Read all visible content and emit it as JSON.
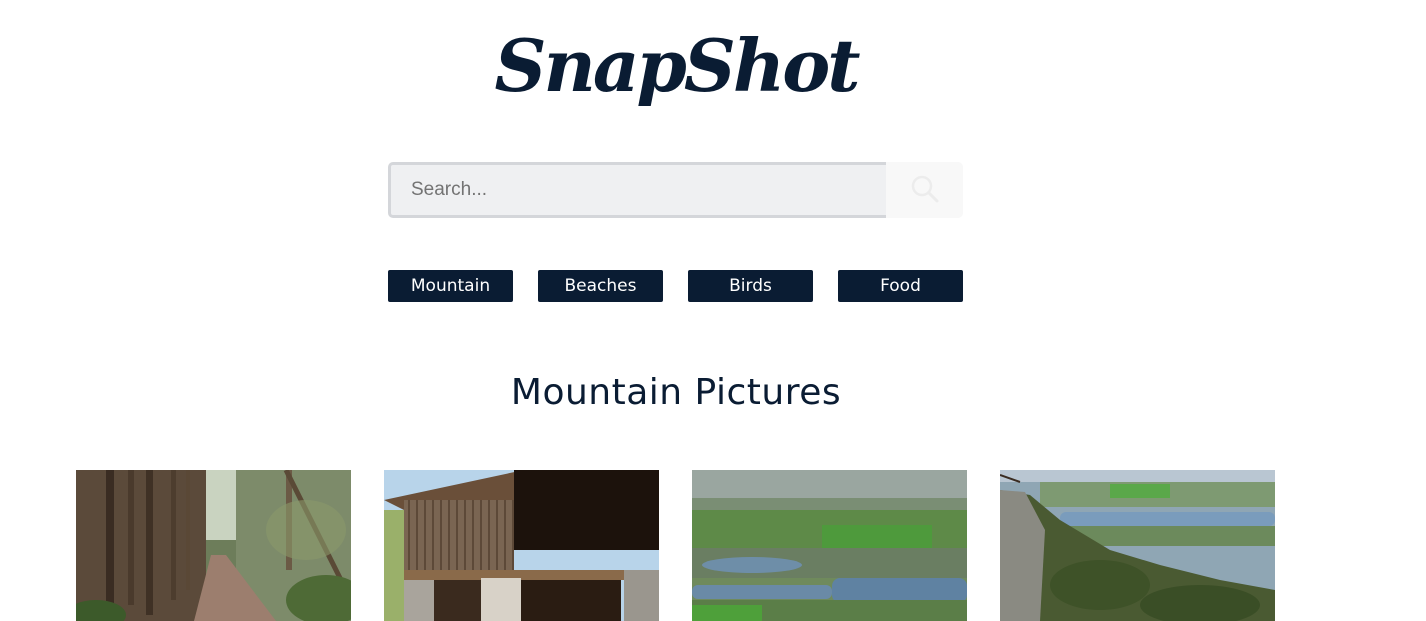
{
  "header": {
    "logo_text": "SnapShot"
  },
  "search": {
    "placeholder": "Search...",
    "value": ""
  },
  "categories": [
    {
      "label": "Mountain"
    },
    {
      "label": "Beaches"
    },
    {
      "label": "Birds"
    },
    {
      "label": "Food"
    }
  ],
  "main": {
    "title": "Mountain Pictures"
  },
  "gallery": [
    {
      "subject": "forest-trail"
    },
    {
      "subject": "wooden-barn"
    },
    {
      "subject": "valley-lakes"
    },
    {
      "subject": "cliff-valley"
    }
  ],
  "colors": {
    "brand": "#0a1c33",
    "search_bg": "#eff0f2",
    "search_border": "#d4d6da",
    "background": "#ffffff"
  }
}
